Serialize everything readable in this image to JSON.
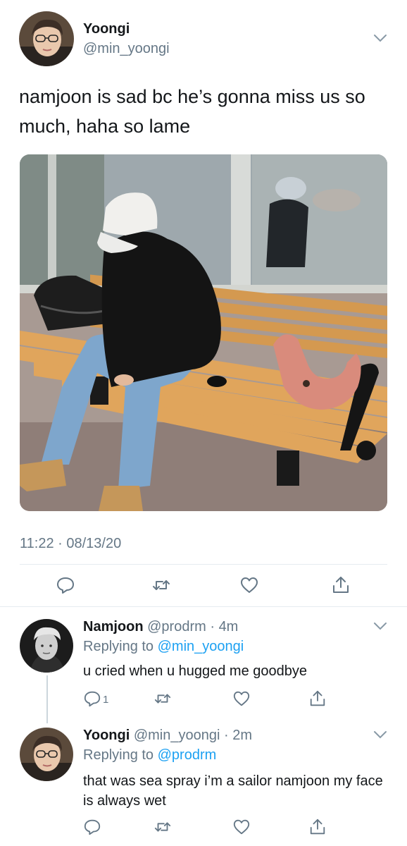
{
  "tweet": {
    "name": "Yoongi",
    "handle": "@min_yoongi",
    "text": "namjoon is sad bc he’s gonna miss us so much, haha so lame",
    "timestamp": "11:22 · 08/13/20",
    "photo_alt": "Person in white cap and black hoodie sitting on a wooden bench at a bus stop with a bag and a pink neck pillow"
  },
  "replies": [
    {
      "name": "Namjoon",
      "handle": "@prodrm",
      "time": "4m",
      "replying_label": "Replying to",
      "replying_handle": "@min_yoongi",
      "text": "u cried when u hugged me goodbye",
      "reply_count": "1"
    },
    {
      "name": "Yoongi",
      "handle": "@min_yoongi",
      "time": "2m",
      "replying_label": "Replying to",
      "replying_handle": "@prodrm",
      "text": "that was sea spray i’m a sailor namjoon my face is always wet"
    }
  ],
  "icons": {
    "reply": "speech-bubble-icon",
    "retweet": "retweet-icon",
    "like": "heart-icon",
    "share": "share-icon",
    "more": "chevron-down-icon"
  },
  "colors": {
    "icon_gray": "#657786",
    "link_blue": "#1da1f2",
    "divider": "#e6ecf0"
  }
}
